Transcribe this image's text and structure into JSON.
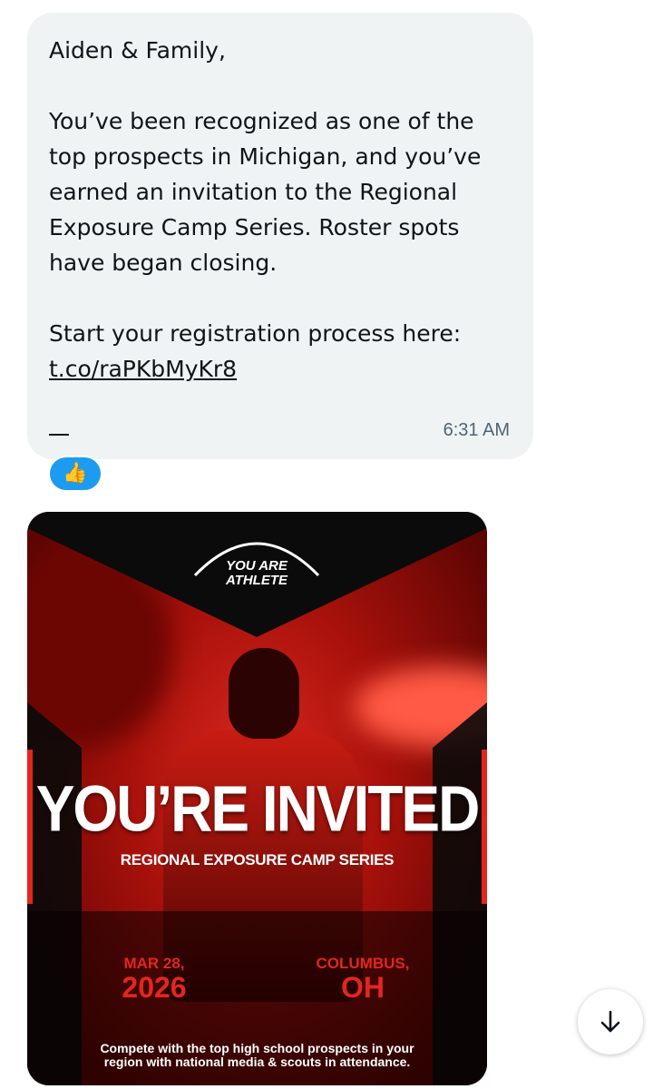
{
  "message": {
    "greeting": "Aiden & Family,",
    "body": "You’ve been recognized as one of the top prospects in Michigan, and you’ve earned an invitation to the Regional Exposure Camp Series. Roster spots have began closing.",
    "cta": "Start your registration process here:",
    "link": "t.co/raPKbMyKr8",
    "timestamp": "6:31 AM",
    "reaction": "👍"
  },
  "flyer": {
    "logo_line1": "YOU ARE",
    "logo_line2": "ATHLETE",
    "headline": "YOU’RE INVITED",
    "subheadline": "REGIONAL EXPOSURE CAMP SERIES",
    "date_line1": "MAR 28,",
    "date_line2": "2026",
    "location_line1": "COLUMBUS,",
    "location_line2": "OH",
    "footer_line1": "Compete with the top high school prospects in your",
    "footer_line2": "region with national media & scouts in attendance."
  },
  "colors": {
    "bubble": "#eff3f4",
    "accent": "#1d9bf0",
    "flyer_red": "#e3261d"
  },
  "icons": {
    "scroll": "arrow-down-icon",
    "reaction": "thumbs-up-icon"
  }
}
